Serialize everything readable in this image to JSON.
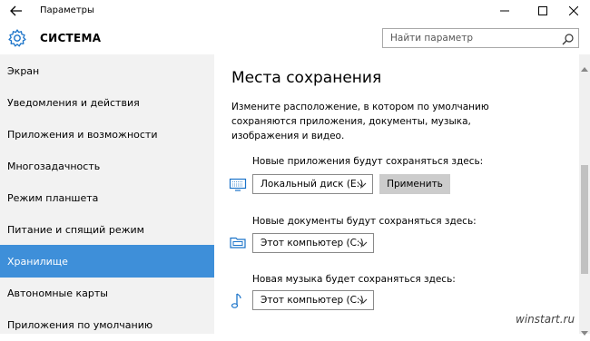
{
  "window": {
    "title": "Параметры",
    "section_title": "СИСТЕМА"
  },
  "search": {
    "placeholder": "Найти параметр"
  },
  "sidebar": {
    "items": [
      {
        "label": "Экран",
        "active": false
      },
      {
        "label": "Уведомления и действия",
        "active": false
      },
      {
        "label": "Приложения и возможности",
        "active": false
      },
      {
        "label": "Многозадачность",
        "active": false
      },
      {
        "label": "Режим планшета",
        "active": false
      },
      {
        "label": "Питание и спящий режим",
        "active": false
      },
      {
        "label": "Хранилище",
        "active": true
      },
      {
        "label": "Автономные карты",
        "active": false
      },
      {
        "label": "Приложения по умолчанию",
        "active": false
      }
    ]
  },
  "main": {
    "heading": "Места сохранения",
    "description": "Измените расположение, в котором по умолчанию сохраняются приложения, документы, музыка, изображения и видео.",
    "apps": {
      "label": "Новые приложения будут сохраняться здесь:",
      "selected": "Локальный диск (E:)",
      "apply_label": "Применить",
      "icon": "monitor-icon"
    },
    "documents": {
      "label": "Новые документы будут сохраняться здесь:",
      "selected": "Этот компьютер (C:)",
      "icon": "folder-icon"
    },
    "music": {
      "label": "Новая музыка будет сохраняться здесь:",
      "selected": "Этот компьютер (C:)",
      "icon": "music-note-icon"
    }
  },
  "colors": {
    "accent": "#3e8fd9",
    "sidebar_bg": "#f2f2f2"
  },
  "watermark": "winstart.ru"
}
